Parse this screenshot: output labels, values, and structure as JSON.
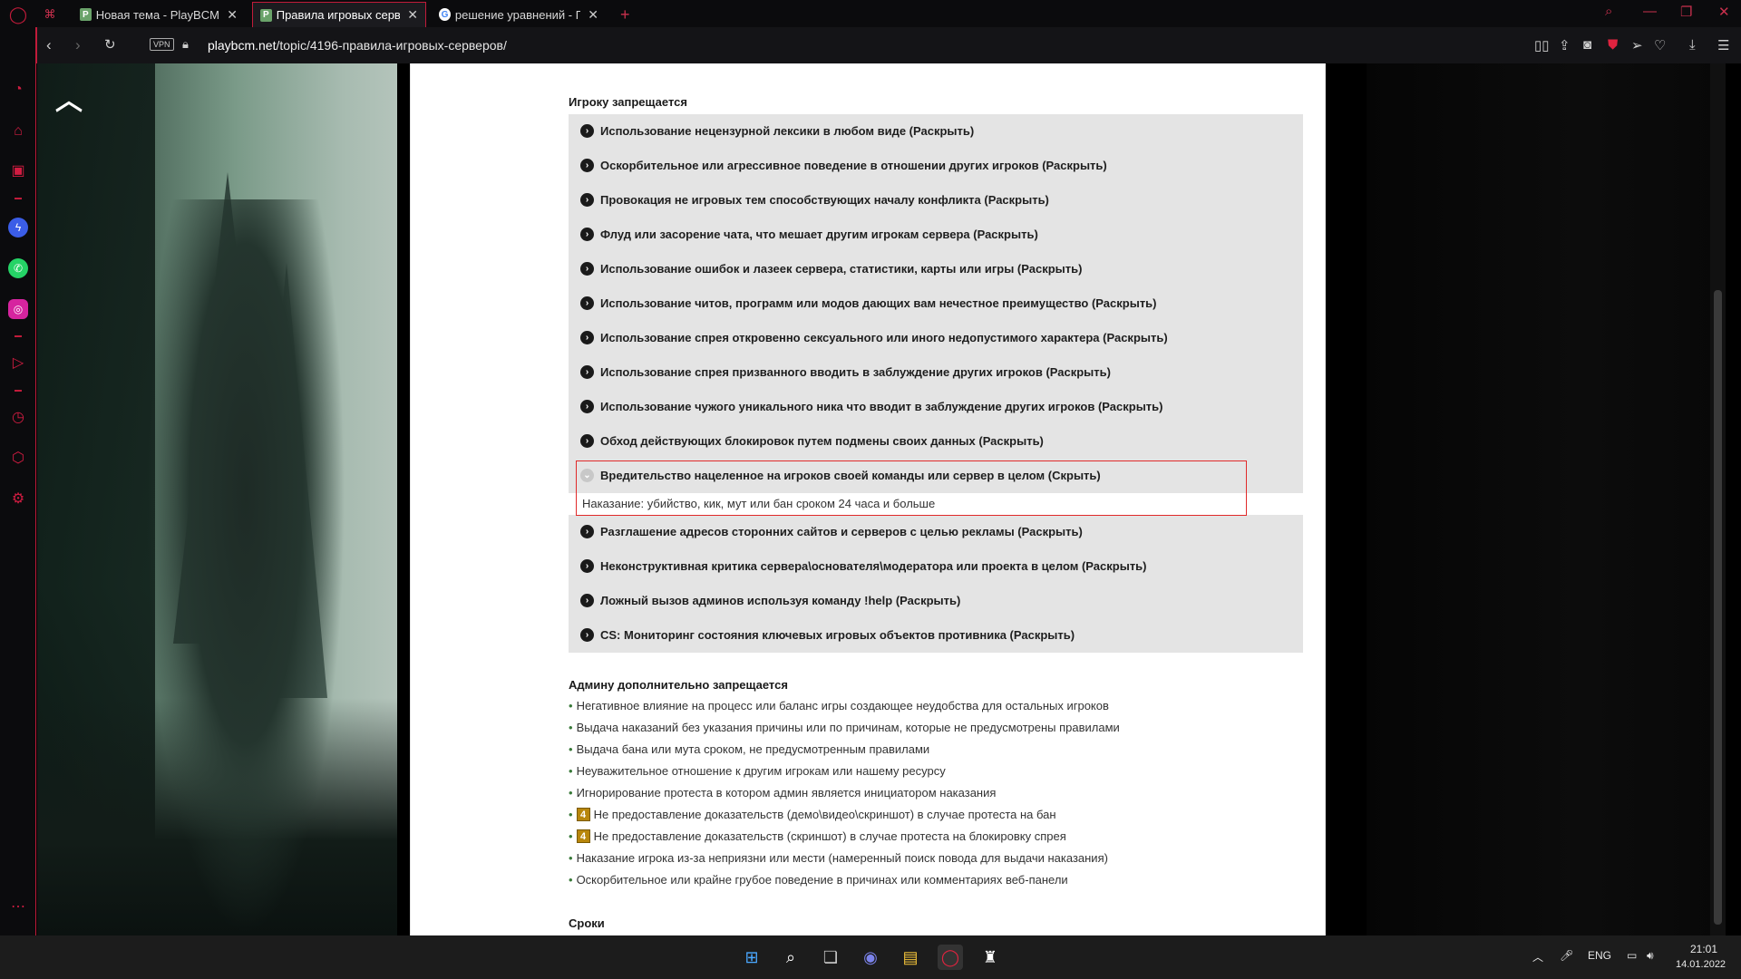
{
  "browser": {
    "tabs": [
      {
        "title": "Новая тема - PlayBCM - И",
        "favicon": "P",
        "active": false
      },
      {
        "title": "Правила игровых сервере",
        "favicon": "P",
        "active": true
      },
      {
        "title": "решение уравнений - По",
        "favicon": "G",
        "active": false
      }
    ],
    "new_tab_label": "+",
    "close_label": "✕",
    "vpn_label": "VPN",
    "url_domain": "playbcm.net",
    "url_path": "/topic/4196-правила-игровых-серверов/"
  },
  "section_player": {
    "title": "Игроку запрещается",
    "rules": [
      "Использование нецензурной лексики в любом виде (Раскрыть)",
      "Оскорбительное или агрессивное поведение в отношении других игроков (Раскрыть)",
      "Провокация не игровых тем способствующих началу конфликта (Раскрыть)",
      "Флуд или засорение чата, что мешает другим игрокам сервера (Раскрыть)",
      "Использование ошибок и лазеек сервера, статистики, карты или игры (Раскрыть)",
      "Использование читов, программ или модов дающих вам нечестное преимущество (Раскрыть)",
      "Использование спрея откровенно сексуального или иного недопустимого характера (Раскрыть)",
      "Использование спрея призванного вводить в заблуждение других игроков (Раскрыть)",
      "Использование чужого уникального ника что вводит в заблуждение других игроков (Раскрыть)",
      "Обход действующих блокировок путем подмены своих данных (Раскрыть)",
      "Вредительство нацеленное на игроков своей команды или сервер в целом (Скрыть)",
      "Разглашение адресов сторонних сайтов и серверов с целью рекламы (Раскрыть)",
      "Неконструктивная критика сервера\\основателя\\модератора или проекта в целом (Раскрыть)",
      "Ложный вызов админов используя команду !help (Раскрыть)",
      "CS: Мониторинг состояния ключевых игровых объектов противника (Раскрыть)"
    ],
    "expanded_text": "Наказание: убийство, кик, мут или бан сроком 24 часа и больше"
  },
  "section_admin": {
    "title": "Админу дополнительно запрещается",
    "items": [
      {
        "text": "Негативное влияние на процесс или баланс игры создающее неудобства для остальных игроков",
        "badge": ""
      },
      {
        "text": "Выдача наказаний без указания причины или по причинам, которые не предусмотрены правилами",
        "badge": ""
      },
      {
        "text": "Выдача бана или мута сроком, не предусмотренным правилами",
        "badge": ""
      },
      {
        "text": "Неуважительное отношение к другим игрокам или нашему ресурсу",
        "badge": ""
      },
      {
        "text": "Игнорирование протеста в котором админ является инициатором наказания",
        "badge": ""
      },
      {
        "text": "Не предоставление доказательств (демо\\видео\\скриншот) в случае протеста на бан",
        "badge": "4"
      },
      {
        "text": "Не предоставление доказательств (скриншот) в случае протеста на блокировку спрея",
        "badge": "4"
      },
      {
        "text": "Наказание игрока из-за неприязни или мести (намеренный поиск повода для выдачи наказания)",
        "badge": ""
      },
      {
        "text": "Оскорбительное или крайне грубое поведение в причинах или комментариях веб-панели",
        "badge": ""
      }
    ]
  },
  "section_terms": {
    "title": "Сроки"
  },
  "taskbar": {
    "lang": "ENG",
    "time": "21:01",
    "date": "14.01.2022"
  },
  "colors": {
    "accent": "#c11b3a",
    "sidebar_icon": "#d11c41",
    "highlight_box": "#e02a2a",
    "rules_bg": "#e4e4e4"
  }
}
